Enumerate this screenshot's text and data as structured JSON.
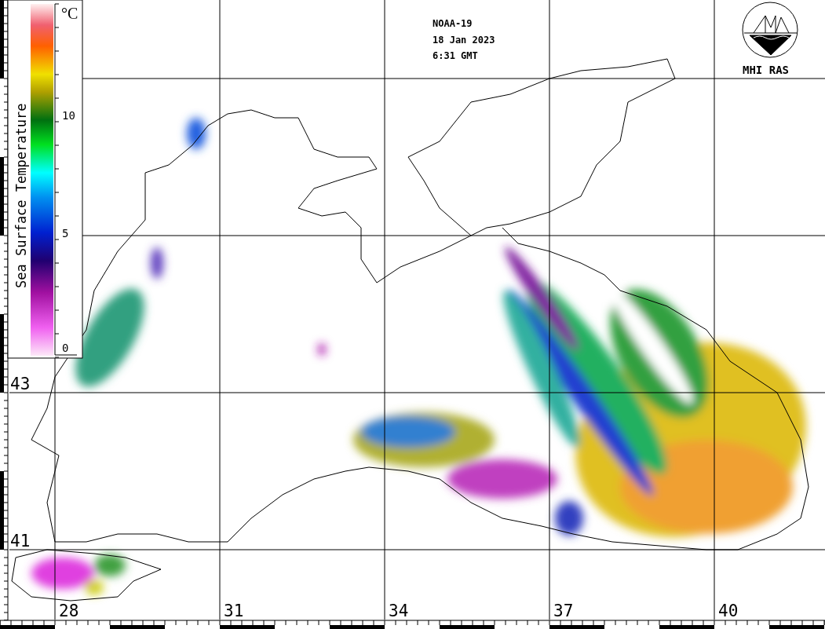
{
  "header": {
    "satellite": "NOAA-19",
    "date": "18 Jan 2023",
    "time": "6:31 GMT"
  },
  "logo": {
    "text": "MHI RAS"
  },
  "colorbar": {
    "title": "Sea Surface Temperature",
    "unit": "°C",
    "ticks": [
      "10",
      "5",
      "0"
    ]
  },
  "latitude_labels": [
    "43",
    "41"
  ],
  "longitude_labels": [
    "28",
    "31",
    "34",
    "37",
    "40"
  ]
}
